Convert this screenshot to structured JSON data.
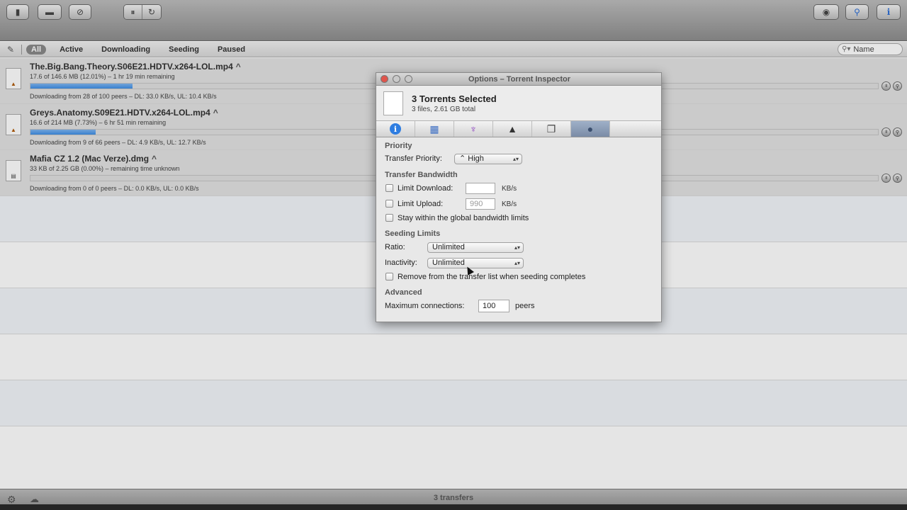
{
  "toolbar": {
    "left_buttons": [
      "document-icon",
      "folder-icon",
      "no-entry-icon"
    ],
    "pause_resume": [
      "pause-all-icon",
      "resume-all-icon"
    ],
    "right_buttons": [
      "quicklook-icon",
      "filter-icon",
      "info-icon"
    ]
  },
  "filters": {
    "items": [
      "All",
      "Active",
      "Downloading",
      "Seeding",
      "Paused"
    ],
    "active": "All",
    "search_placeholder": "Name"
  },
  "torrents": [
    {
      "name": "The.Big.Bang.Theory.S06E21.HDTV.x264-LOL.mp4",
      "progress_text": "17.6 of 146.6 MB (12.01%) – 1 hr 19 min remaining",
      "progress": 0.12,
      "status": "Downloading from 28 of 100 peers – DL: 33.0 KB/s, UL: 10.4 KB/s"
    },
    {
      "name": "Greys.Anatomy.S09E21.HDTV.x264-LOL.mp4",
      "progress_text": "16.6 of 214 MB (7.73%) – 6 hr 51 min remaining",
      "progress": 0.077,
      "status": "Downloading from 9 of 66 peers – DL: 4.9 KB/s, UL: 12.7 KB/s"
    },
    {
      "name": "Mafia CZ 1.2 (Mac Verze).dmg",
      "progress_text": "33 KB of 2.25 GB (0.00%) – remaining time unknown",
      "progress": 0.0,
      "status": "Downloading from 0 of 0 peers – DL: 0.0 KB/s, UL: 0.0 KB/s"
    }
  ],
  "inspector": {
    "title": "Options – Torrent Inspector",
    "heading": "3 Torrents Selected",
    "subheading": "3 files, 2.61 GB total",
    "sections": {
      "priority": "Priority",
      "bandwidth": "Transfer Bandwidth",
      "seeding": "Seeding Limits",
      "advanced": "Advanced"
    },
    "transfer_priority_label": "Transfer Priority:",
    "transfer_priority_value": "High",
    "limit_download_label": "Limit Download:",
    "limit_download_value": "",
    "limit_upload_label": "Limit Upload:",
    "limit_upload_value": "990",
    "unit_kbs": "KB/s",
    "stay_within_label": "Stay within the global bandwidth limits",
    "ratio_label": "Ratio:",
    "ratio_value": "Unlimited",
    "inactivity_label": "Inactivity:",
    "inactivity_value": "Unlimited",
    "remove_label": "Remove from the transfer list when seeding completes",
    "max_connections_label": "Maximum connections:",
    "max_connections_value": "100",
    "peers_unit": "peers"
  },
  "statusbar": {
    "transfers": "3 transfers"
  }
}
